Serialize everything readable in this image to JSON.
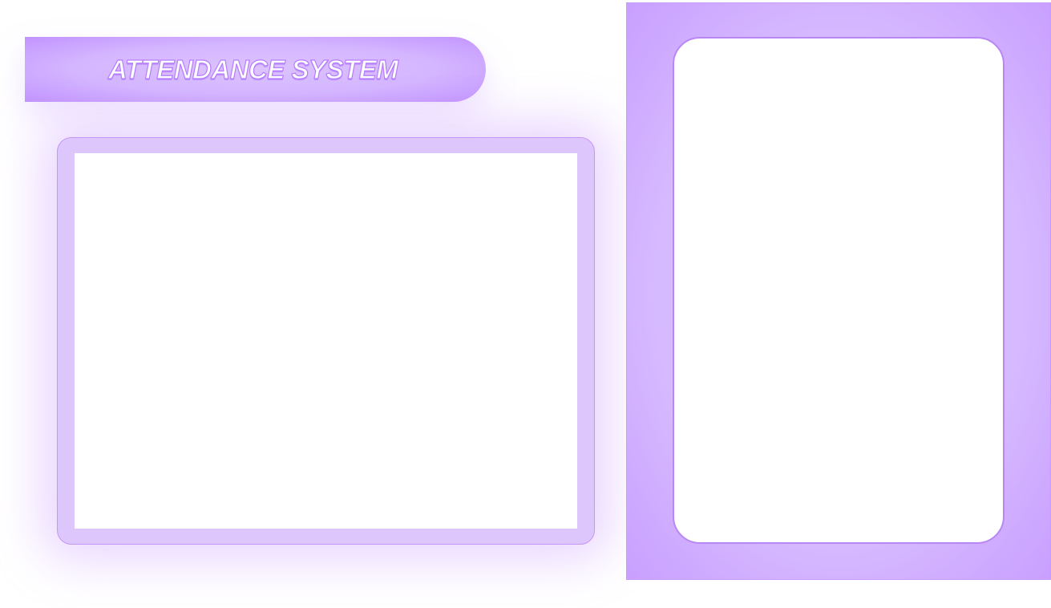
{
  "header": {
    "title": "ATTENDANCE SYSTEM"
  },
  "theme": {
    "accent": "#c596f7",
    "panel_fill": "#ddc6fb",
    "surface": "#ffffff"
  }
}
